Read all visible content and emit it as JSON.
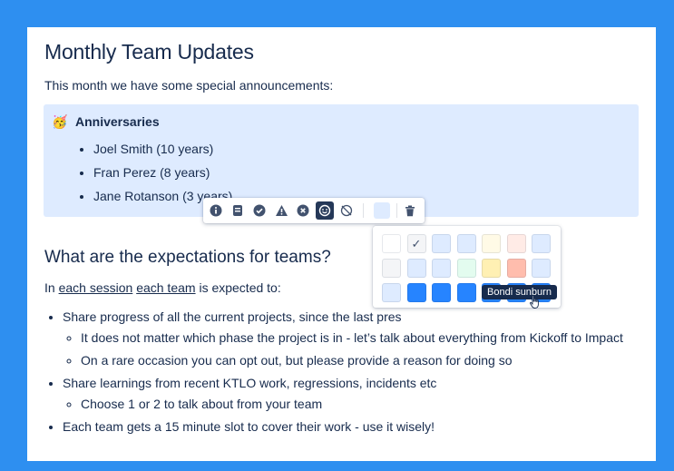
{
  "page": {
    "title": "Monthly Team Updates",
    "intro": "This month we have some special announcements:"
  },
  "panel": {
    "emoji": "🥳",
    "title": "Anniversaries",
    "items": [
      "Joel Smith (10 years)",
      "Fran Perez (8 years)",
      "Jane Rotanson (3 years)"
    ]
  },
  "toolbar": {
    "buttons": [
      "info-icon",
      "note-icon",
      "success-icon",
      "warning-icon",
      "error-icon",
      "emoji-icon",
      "emoji-off-icon",
      "background-color-swatch",
      "delete-icon"
    ]
  },
  "section": {
    "heading": "What are the expectations for teams?",
    "para_prefix": "In ",
    "para_link1": "each session",
    "para_space": " ",
    "para_link2": "each team",
    "para_suffix": " is expected to:"
  },
  "list": {
    "item1": "Share progress of all the current projects, since the last pres",
    "item1_sub1": "It does not matter which phase the project is in - let’s talk about everything from Kickoff to Impact",
    "item1_sub2": "On a rare occasion you can opt out, but please provide a reason for doing so",
    "item2": "Share learnings from recent KTLO work, regressions, incidents etc",
    "item2_sub1": "Choose 1 or 2 to talk about from your team",
    "item3": "Each team gets a 15 minute slot to cover their work - use it wisely!"
  },
  "palette": {
    "colors": [
      [
        "#ffffff",
        "#f4f5f7",
        "#deebff",
        "#deebff",
        "#fffae6",
        "#ffebe6",
        "#deebff"
      ],
      [
        "#f4f5f7",
        "#deebff",
        "#deebff",
        "#e3fcef",
        "#fff0b3",
        "#ffbdad",
        "#deebff"
      ],
      [
        "#deebff",
        "#2684ff",
        "#2684ff",
        "#2684ff",
        "#2684ff",
        "#2684ff",
        "#2684ff"
      ]
    ],
    "selected_check": "✓",
    "tooltip": "Bondi sunburn"
  },
  "colors": {
    "frame": "#2e8ff0",
    "panel_bg": "#deebff",
    "text": "#172b4d"
  }
}
